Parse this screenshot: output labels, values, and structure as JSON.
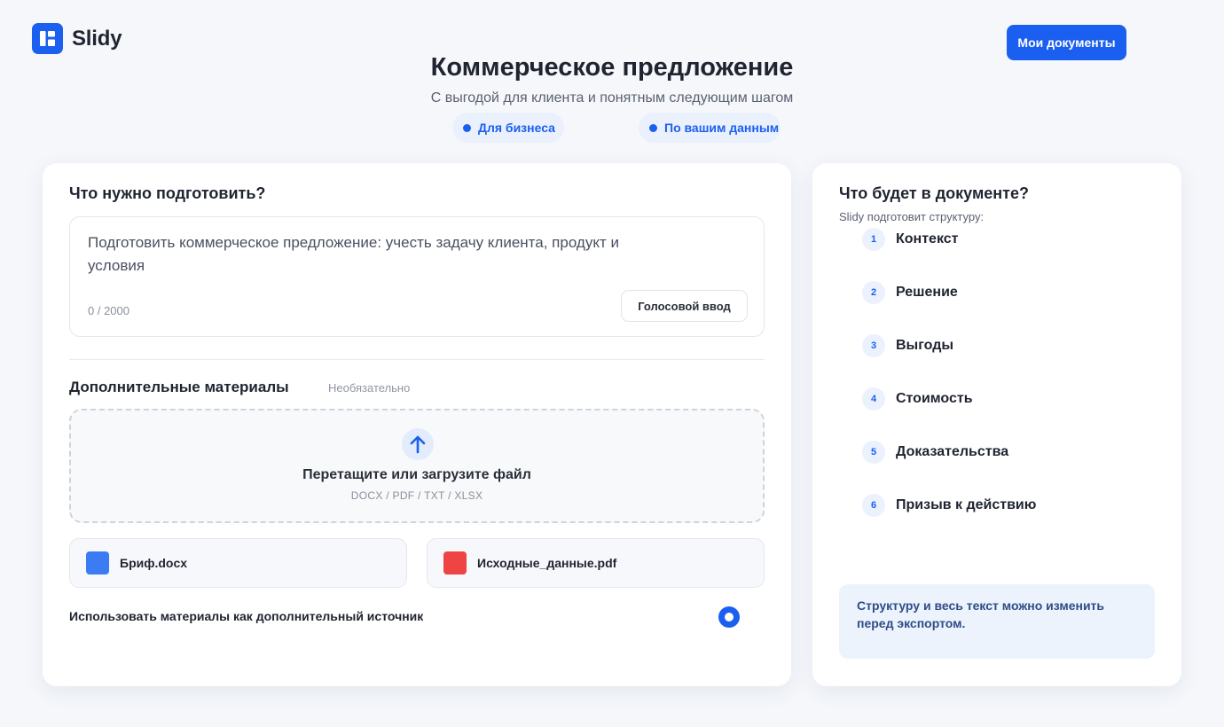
{
  "app": {
    "name": "Slidy"
  },
  "header": {
    "my_documents_label": "Мои документы",
    "title": "Коммерческое предложение",
    "subtitle": "С выгодой для клиента и понятным следующим шагом",
    "chips": [
      "Для бизнеса",
      "По вашим данным"
    ]
  },
  "form": {
    "section_title": "Что нужно подготовить?",
    "prompt_value": "Подготовить коммерческое предложение: учесть задачу клиента, продукт и условия",
    "counter": "0 / 2000",
    "voice_button_label": "Голосовой ввод",
    "materials_title": "Дополнительные материалы",
    "materials_optional": "Необязательно",
    "dropzone": {
      "title": "Перетащите или загрузите файл",
      "formats": "DOCX / PDF / TXT / XLSX"
    },
    "files": [
      {
        "name": "Бриф.docx",
        "color": "#3b7cf5"
      },
      {
        "name": "Исходные_данные.pdf",
        "color": "#ef4444"
      }
    ],
    "use_materials_label": "Использовать материалы как дополнительный источник"
  },
  "structure": {
    "title": "Что будет в документе?",
    "subtitle": "Slidy подготовит структуру:",
    "steps": [
      {
        "num": "1",
        "label": "Контекст"
      },
      {
        "num": "2",
        "label": "Решение"
      },
      {
        "num": "3",
        "label": "Выгоды"
      },
      {
        "num": "4",
        "label": "Стоимость"
      },
      {
        "num": "5",
        "label": "Доказательства"
      },
      {
        "num": "6",
        "label": "Призыв к действию"
      }
    ],
    "note": "Структуру и весь текст можно изменить перед экспортом."
  },
  "colors": {
    "accent": "#1b5ff0",
    "background": "#f5f7fb",
    "card": "#ffffff"
  },
  "icons": {
    "logo": "slidy-logo-icon",
    "upload": "upload-arrow-icon",
    "file": "file-icon"
  }
}
